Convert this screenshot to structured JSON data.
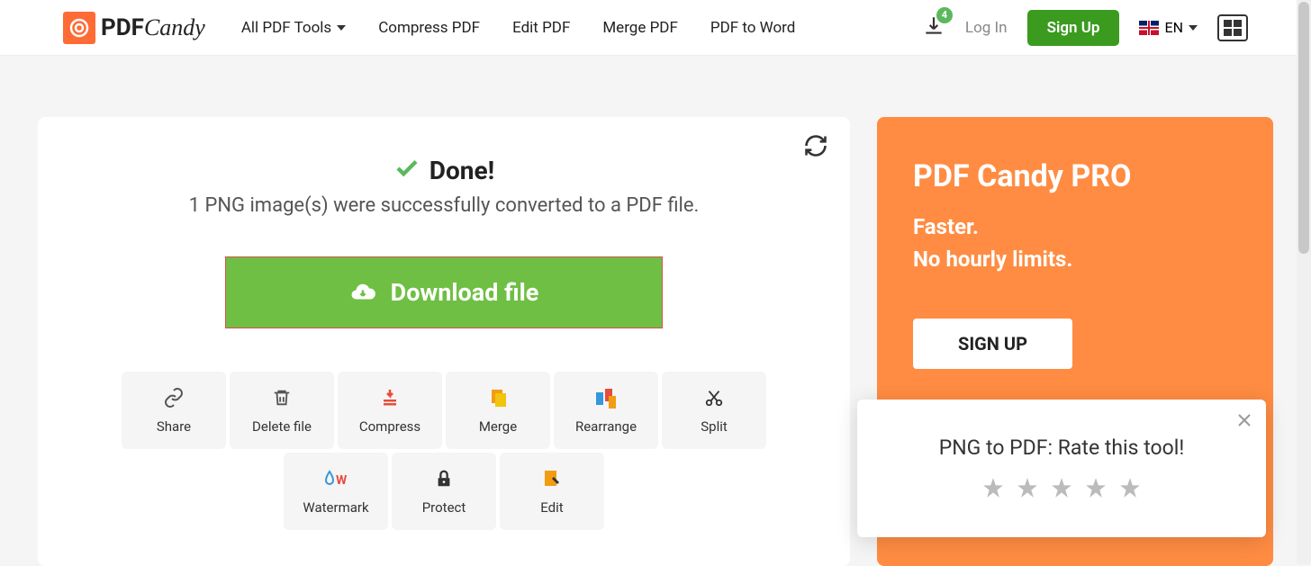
{
  "header": {
    "logo_text_main": "PDF",
    "logo_text_sub": "Candy",
    "nav": [
      "All PDF Tools",
      "Compress PDF",
      "Edit PDF",
      "Merge PDF",
      "PDF to Word"
    ],
    "download_badge": "4",
    "login": "Log In",
    "signup": "Sign Up",
    "lang": "EN"
  },
  "main": {
    "done": "Done!",
    "subtitle": "1 PNG image(s) were successfully converted to a PDF file.",
    "download_label": "Download file",
    "actions": [
      {
        "label": "Share",
        "icon": "link-icon"
      },
      {
        "label": "Delete file",
        "icon": "trash-icon"
      },
      {
        "label": "Compress",
        "icon": "compress-icon"
      },
      {
        "label": "Merge",
        "icon": "merge-icon"
      },
      {
        "label": "Rearrange",
        "icon": "rearrange-icon"
      },
      {
        "label": "Split",
        "icon": "scissors-icon"
      },
      {
        "label": "Watermark",
        "icon": "watermark-icon"
      },
      {
        "label": "Protect",
        "icon": "lock-icon"
      },
      {
        "label": "Edit",
        "icon": "edit-icon"
      }
    ]
  },
  "promo": {
    "title": "PDF Candy PRO",
    "line1": "Faster.",
    "line2": "No hourly limits.",
    "cta": "SIGN UP"
  },
  "rate": {
    "text": "PNG to PDF: Rate this tool!",
    "star_count": 5
  },
  "colors": {
    "accent_green": "#6fbf44",
    "header_green": "#3a9b1f",
    "promo_orange": "#ff8c42",
    "logo_orange": "#ff6b35"
  }
}
